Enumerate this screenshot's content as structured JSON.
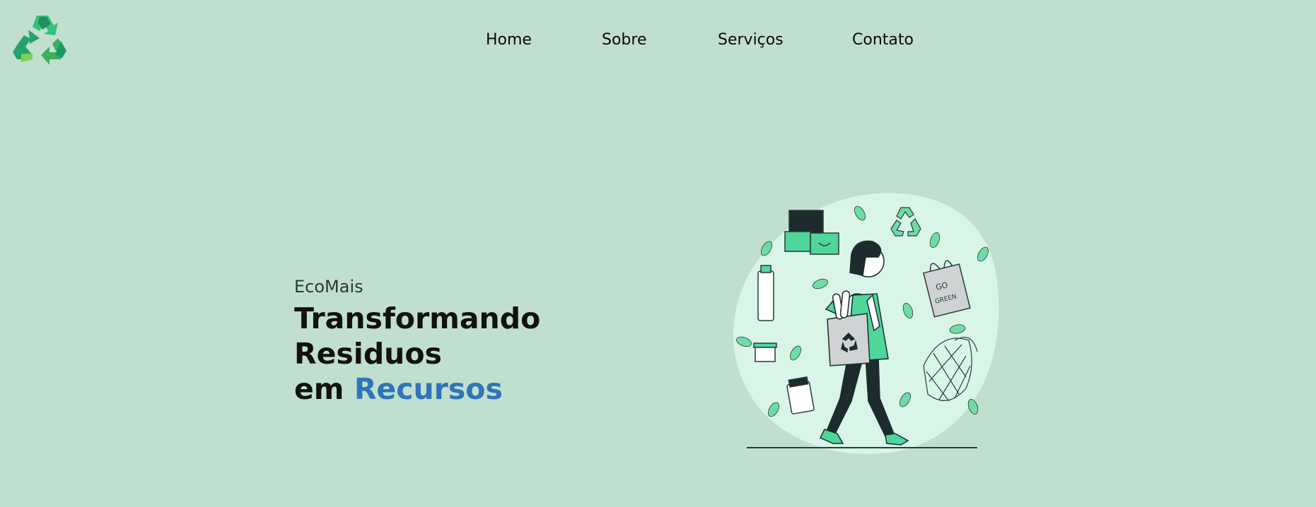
{
  "brand": {
    "logo_icon": "recycle-icon",
    "colors": {
      "background": "#c1dfcf",
      "accent": "#2f74b9",
      "green": "#3fd58e",
      "dark": "#1d2b2e"
    }
  },
  "nav": {
    "items": [
      {
        "label": "Home"
      },
      {
        "label": "Sobre"
      },
      {
        "label": "Serviços"
      },
      {
        "label": "Contato"
      }
    ]
  },
  "hero": {
    "kicker": "EcoMais",
    "headline_line1": "Transformando Residuos",
    "headline_prefix": "em",
    "headline_accent": "Recursos",
    "illustration_text": "GO GREEN"
  }
}
